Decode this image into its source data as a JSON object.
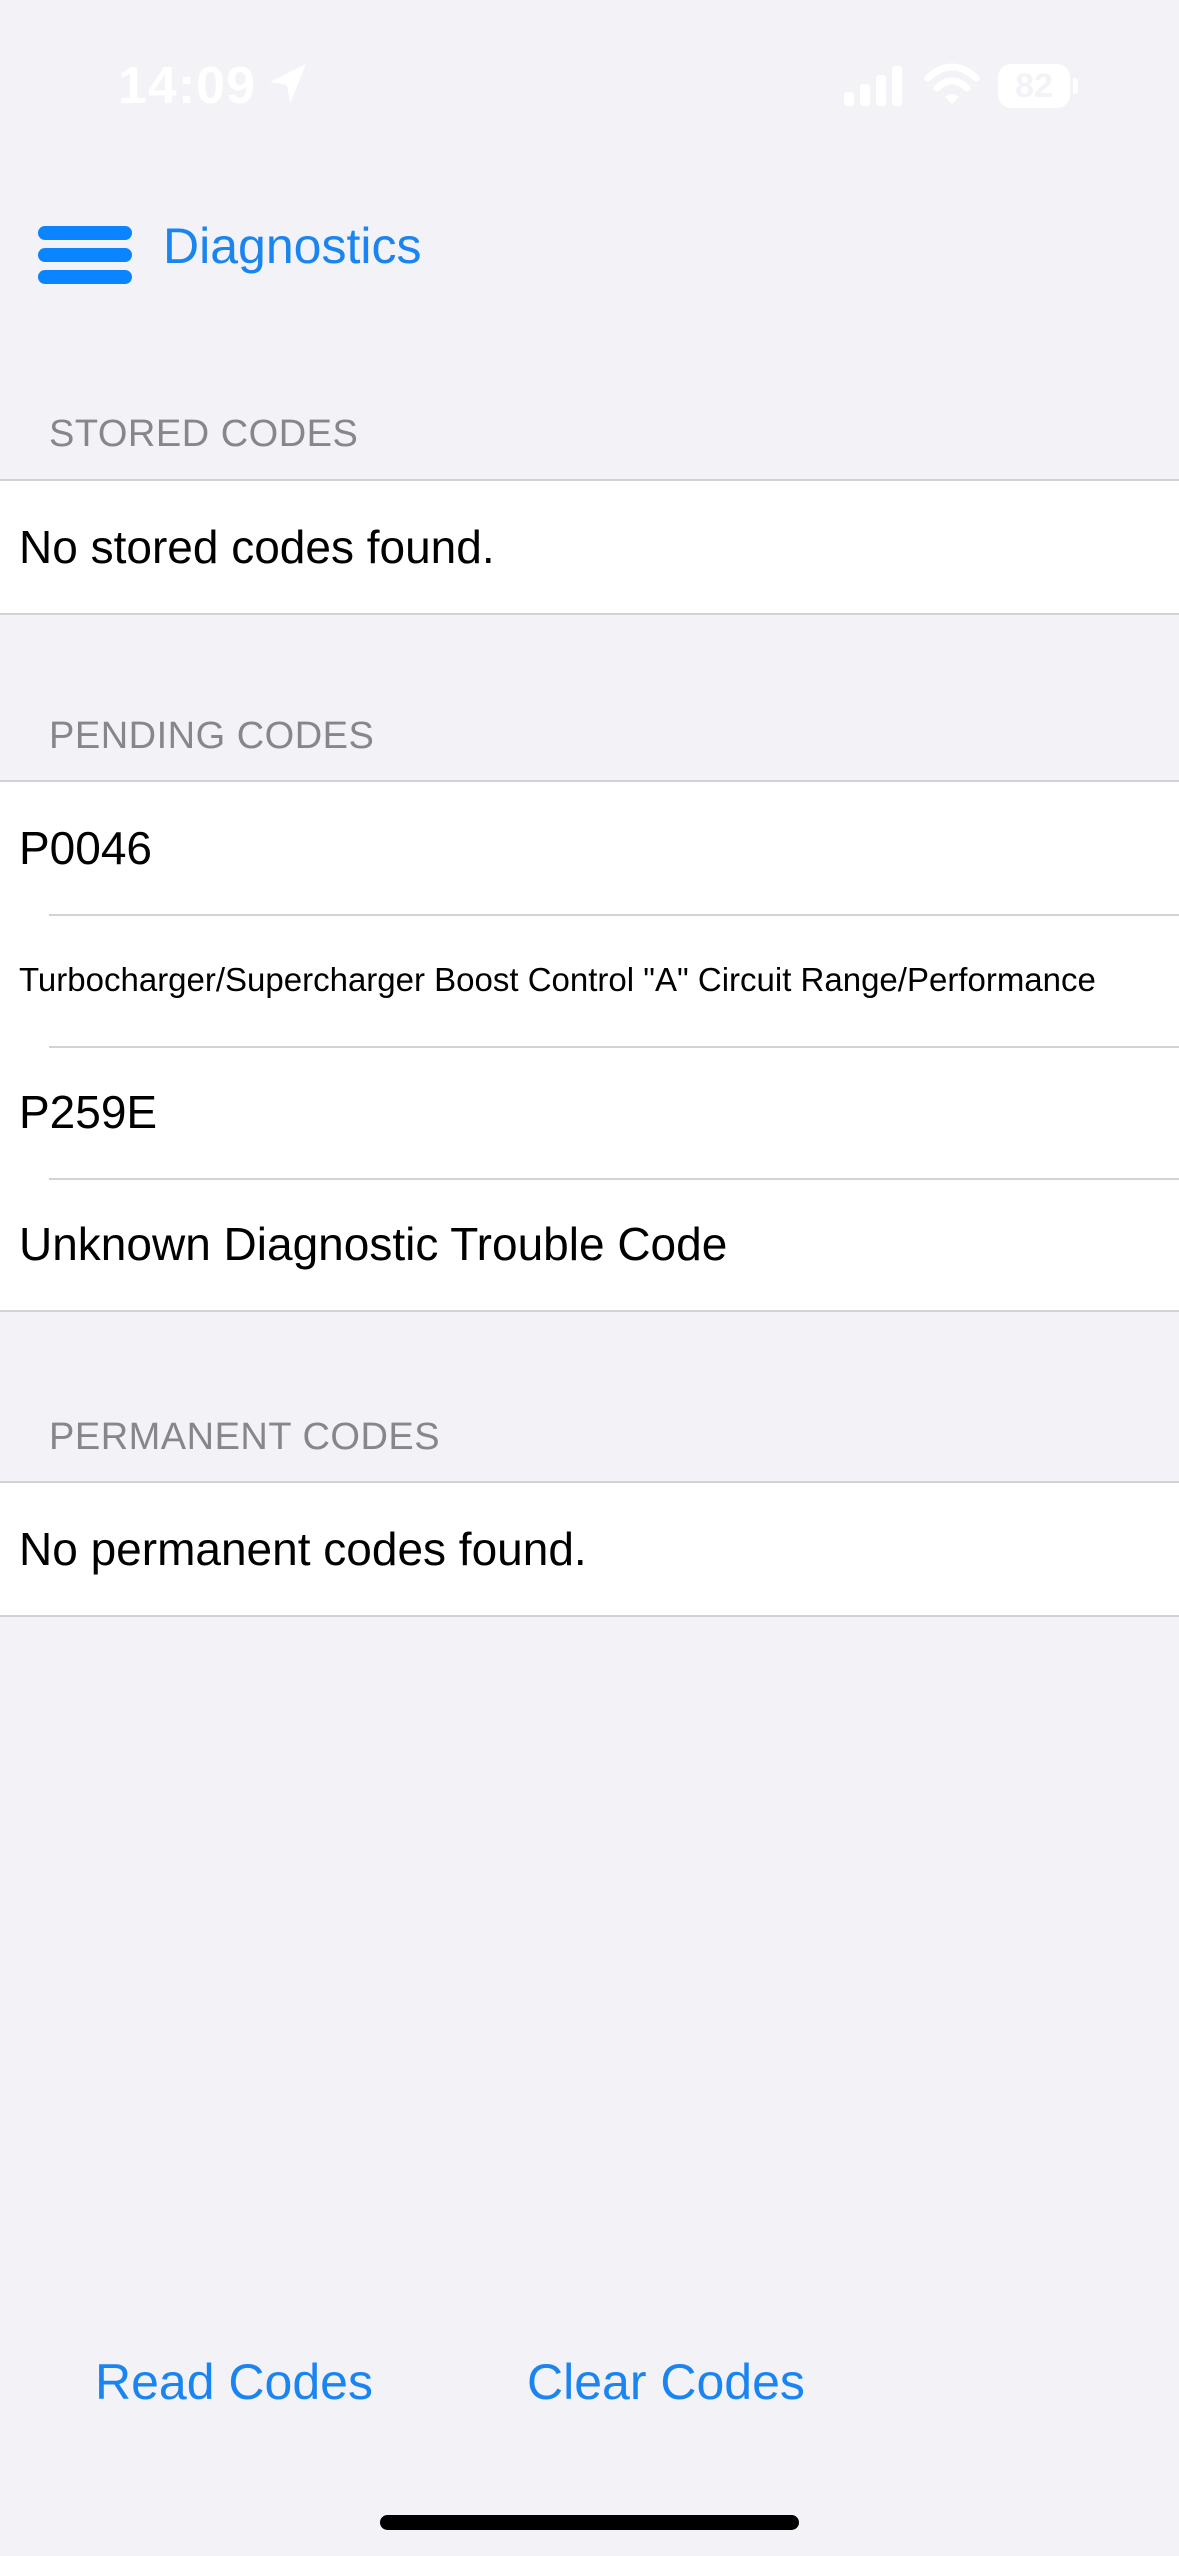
{
  "status_bar": {
    "time": "14:09",
    "battery_level": "82",
    "icons": [
      "location-arrow-icon",
      "cellular-signal-icon",
      "wifi-icon",
      "battery-icon"
    ]
  },
  "nav": {
    "title": "Diagnostics",
    "menu_icon": "hamburger-menu-icon"
  },
  "sections": {
    "stored": {
      "header": "STORED CODES",
      "rows": [
        "No stored codes found."
      ]
    },
    "pending": {
      "header": "PENDING CODES",
      "rows": [
        "P0046",
        "Turbocharger/Supercharger Boost Control \"A\" Circuit Range/Performance",
        "P259E",
        "Unknown Diagnostic Trouble Code"
      ]
    },
    "permanent": {
      "header": "PERMANENT CODES",
      "rows": [
        "No permanent codes found."
      ]
    }
  },
  "toolbar": {
    "read_label": "Read Codes",
    "clear_label": "Clear Codes"
  },
  "colors": {
    "accent": "#1a84f0",
    "background": "#f2f2f7",
    "section_header": "#86868b",
    "separator": "#d1d1d6"
  }
}
